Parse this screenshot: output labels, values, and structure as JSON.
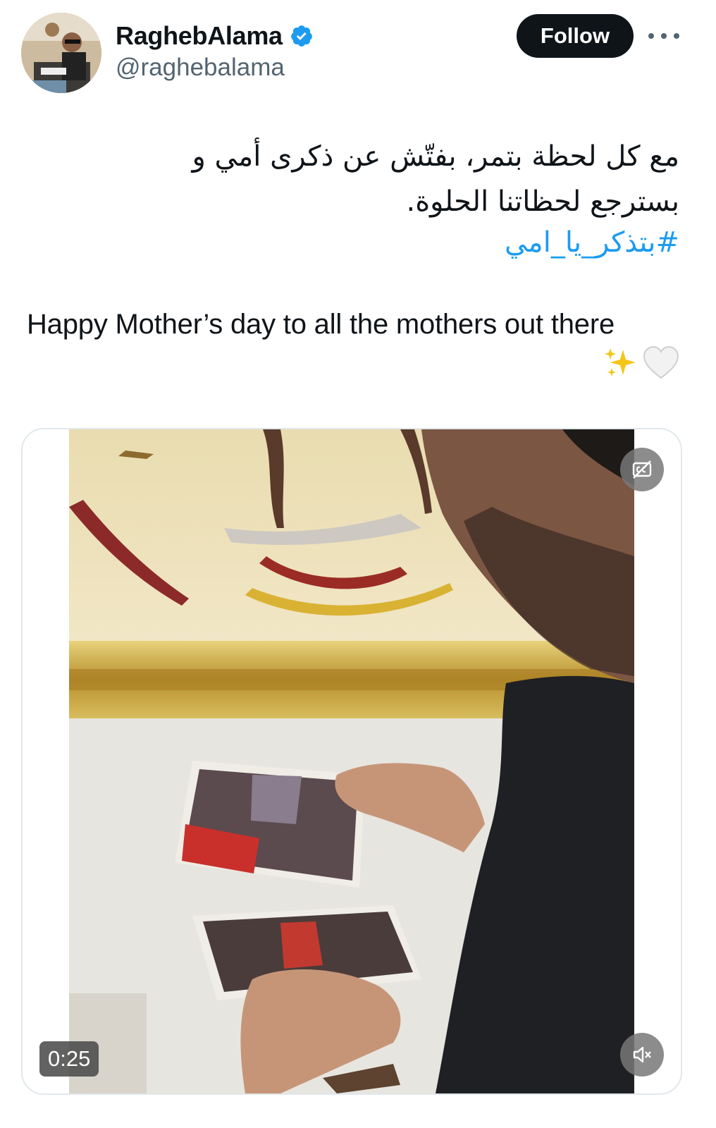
{
  "author": {
    "display_name": "RaghebAlama",
    "handle": "@raghebalama",
    "verified": true,
    "avatar": "avatar-photo"
  },
  "actions": {
    "follow_label": "Follow",
    "more_icon": "more-horizontal-icon"
  },
  "tweet": {
    "arabic_text": "مع كل لحظة بتمر، بفتّش عن ذكرى أمي و بسترجع لحظاتنا الحلوة.",
    "hashtag": "#بتذكر_يا_امي",
    "english_text": "Happy Mother’s day to all the mothers out there",
    "emojis": [
      "white-heart-icon",
      "sparkles-icon"
    ]
  },
  "media": {
    "type": "video",
    "duration": "0:25",
    "captions_icon": "captions-off-icon",
    "mute_icon": "muted-speaker-icon"
  },
  "colors": {
    "link": "#1d9bf0",
    "verified_badge": "#1d9bf0",
    "follow_bg": "#0f1419",
    "secondary_text": "#536471"
  }
}
